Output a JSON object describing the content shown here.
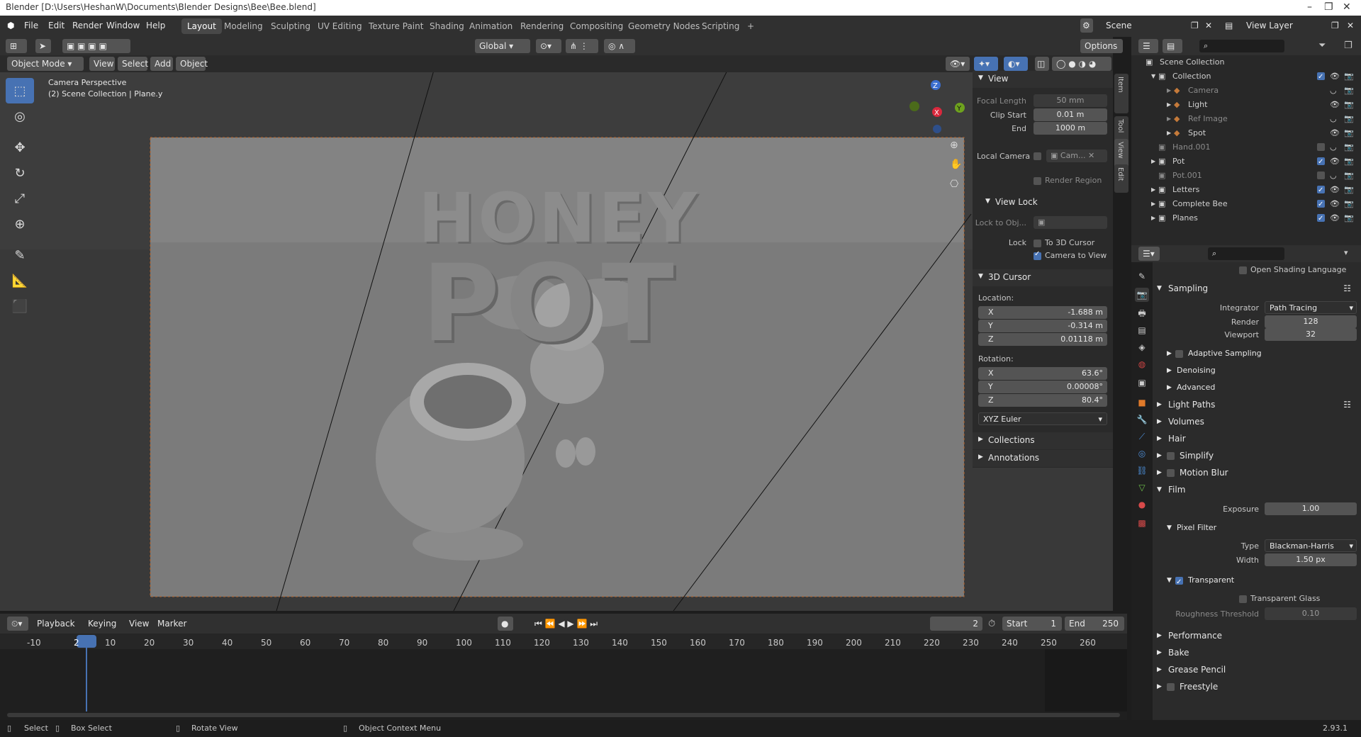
{
  "window": {
    "title": "Blender [D:\\Users\\HeshanW\\Documents\\Blender Designs\\Bee\\Bee.blend]"
  },
  "menu": [
    "File",
    "Edit",
    "Render",
    "Window",
    "Help"
  ],
  "workspaces": [
    "Layout",
    "Modeling",
    "Sculpting",
    "UV Editing",
    "Texture Paint",
    "Shading",
    "Animation",
    "Rendering",
    "Compositing",
    "Geometry Nodes",
    "Scripting",
    "+"
  ],
  "scene": {
    "scene_label": "Scene",
    "view_layer_label": "View Layer"
  },
  "header": {
    "transform_orientation": "Global",
    "options": "Options"
  },
  "viewport_header": {
    "mode": "Object Mode",
    "menus": [
      "View",
      "Select",
      "Add",
      "Object"
    ]
  },
  "viewport": {
    "info_line1": "Camera Perspective",
    "info_line2": "(2) Scene Collection | Plane.y",
    "logo_word1": "HONEY",
    "logo_word2": "POT"
  },
  "gizmo": {
    "x": "X",
    "y": "Y",
    "z": "Z"
  },
  "npanel": {
    "tabs": [
      "Item",
      "Tool",
      "View",
      "Edit"
    ],
    "view_section": "View",
    "focal_length_label": "Focal Length",
    "focal_length": "50 mm",
    "clip_start_label": "Clip Start",
    "clip_start": "0.01 m",
    "end_label": "End",
    "end": "1000 m",
    "local_camera_label": "Local Camera",
    "local_camera_value": "Cam...",
    "render_region_label": "Render Region",
    "view_lock_section": "View Lock",
    "lock_to_obj_label": "Lock to Obj...",
    "lock_label": "Lock",
    "to_3d_cursor": "To 3D Cursor",
    "camera_to_view": "Camera to View",
    "cursor_section": "3D Cursor",
    "location_label": "Location:",
    "loc": [
      {
        "axis": "X",
        "value": "-1.688 m"
      },
      {
        "axis": "Y",
        "value": "-0.314 m"
      },
      {
        "axis": "Z",
        "value": "0.01118 m"
      }
    ],
    "rotation_label": "Rotation:",
    "rot": [
      {
        "axis": "X",
        "value": "63.6°"
      },
      {
        "axis": "Y",
        "value": "0.00008°"
      },
      {
        "axis": "Z",
        "value": "80.4°"
      }
    ],
    "rotation_mode": "XYZ Euler",
    "collections_section": "Collections",
    "annotations_section": "Annotations"
  },
  "outliner": {
    "root": "Scene Collection",
    "rows": [
      {
        "name": "Collection",
        "indent": 1,
        "dim": false
      },
      {
        "name": "Camera",
        "indent": 2,
        "dim": true
      },
      {
        "name": "Light",
        "indent": 2,
        "dim": false
      },
      {
        "name": "Ref Image",
        "indent": 2,
        "dim": true
      },
      {
        "name": "Spot",
        "indent": 2,
        "dim": false
      },
      {
        "name": "Hand.001",
        "indent": 1,
        "dim": true
      },
      {
        "name": "Pot",
        "indent": 1,
        "dim": false
      },
      {
        "name": "Pot.001",
        "indent": 1,
        "dim": true
      },
      {
        "name": "Letters",
        "indent": 1,
        "dim": false
      },
      {
        "name": "Complete Bee",
        "indent": 1,
        "dim": false
      },
      {
        "name": "Planes",
        "indent": 1,
        "dim": false
      }
    ]
  },
  "properties": {
    "open_shading_language": "Open Shading Language",
    "sampling": "Sampling",
    "integrator_label": "Integrator",
    "integrator": "Path Tracing",
    "render_label": "Render",
    "render": "128",
    "viewport_label": "Viewport",
    "viewport": "32",
    "adaptive_sampling": "Adaptive Sampling",
    "denoising": "Denoising",
    "advanced": "Advanced",
    "light_paths": "Light Paths",
    "volumes": "Volumes",
    "hair": "Hair",
    "simplify": "Simplify",
    "motion_blur": "Motion Blur",
    "film": "Film",
    "exposure_label": "Exposure",
    "exposure": "1.00",
    "pixel_filter": "Pixel Filter",
    "type_label": "Type",
    "type": "Blackman-Harris",
    "width_label": "Width",
    "width": "1.50 px",
    "transparent": "Transparent",
    "transparent_glass": "Transparent Glass",
    "roughness_threshold_label": "Roughness Threshold",
    "roughness_threshold": "0.10",
    "performance": "Performance",
    "bake": "Bake",
    "grease_pencil": "Grease Pencil",
    "freestyle": "Freestyle"
  },
  "timeline": {
    "menus": [
      "Playback",
      "Keying",
      "View",
      "Marker"
    ],
    "current_frame": "2",
    "start_label": "Start",
    "start": "1",
    "end_label": "End",
    "end": "250",
    "ruler": [
      "-10",
      "2",
      "10",
      "20",
      "30",
      "40",
      "50",
      "60",
      "70",
      "80",
      "90",
      "100",
      "110",
      "120",
      "130",
      "140",
      "150",
      "160",
      "170",
      "180",
      "190",
      "200",
      "210",
      "220",
      "230",
      "240",
      "250",
      "260"
    ]
  },
  "statusbar": {
    "select": "Select",
    "box_select": "Box Select",
    "rotate_view": "Rotate View",
    "context_menu": "Object Context Menu",
    "version": "2.93.1"
  }
}
